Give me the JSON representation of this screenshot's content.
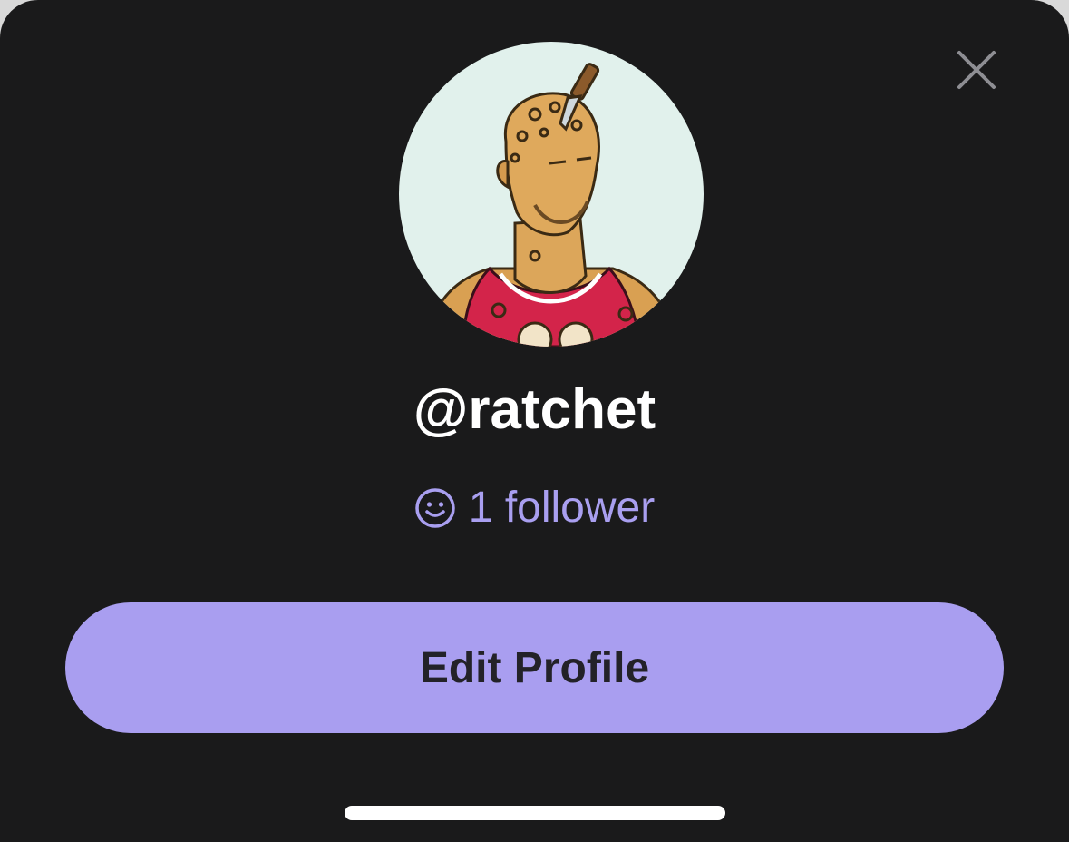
{
  "profile": {
    "username": "@ratchet",
    "followers_text": "1 follower",
    "avatar_alt": "profile avatar"
  },
  "actions": {
    "edit_profile_label": "Edit Profile"
  },
  "icons": {
    "close": "close-icon",
    "followers": "smiley-face-icon"
  },
  "colors": {
    "background": "#1a1a1b",
    "accent": "#a99ef0",
    "button_text": "#232228",
    "avatar_bg": "#e1f1ec"
  }
}
